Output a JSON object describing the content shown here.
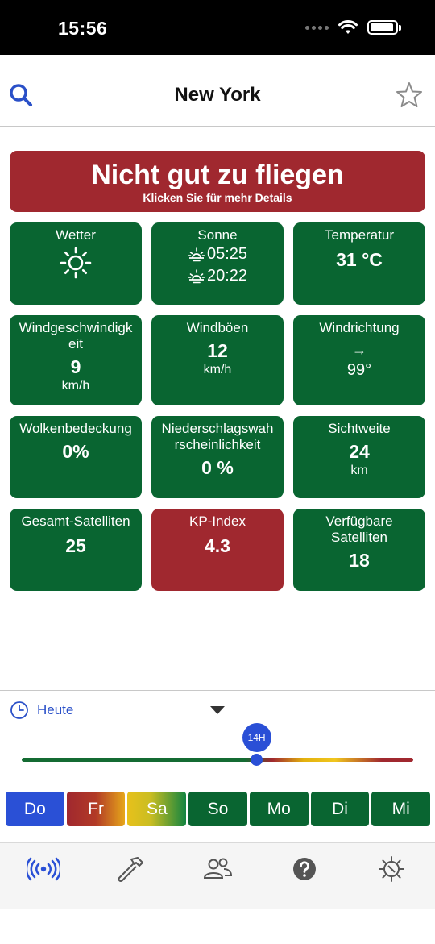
{
  "status_bar": {
    "time": "15:56"
  },
  "header": {
    "title": "New York"
  },
  "banner": {
    "title": "Nicht gut zu fliegen",
    "subtitle": "Klicken Sie für mehr Details"
  },
  "cards": {
    "weather": {
      "label": "Wetter",
      "icon": "sun-icon"
    },
    "sun": {
      "label": "Sonne",
      "sunrise": "05:25",
      "sunset": "20:22"
    },
    "temperature": {
      "label": "Temperatur",
      "value": "31 °C"
    },
    "wind_speed": {
      "label": "Windgeschwindigkeit",
      "value": "9",
      "unit": "km/h"
    },
    "wind_gusts": {
      "label": "Windböen",
      "value": "12",
      "unit": "km/h"
    },
    "wind_direction": {
      "label": "Windrichtung",
      "arrow": "→",
      "value": "99°"
    },
    "cloud_cover": {
      "label": "Wolkenbedeckung",
      "value": "0%"
    },
    "precipitation": {
      "label": "Niederschlagswahrscheinlichkeit",
      "value": "0 %"
    },
    "visibility": {
      "label": "Sichtweite",
      "value": "24",
      "unit": "km"
    },
    "total_satellites": {
      "label": "Gesamt-Satelliten",
      "value": "25"
    },
    "kp_index": {
      "label": "KP-Index",
      "value": "4.3"
    },
    "available_satellites": {
      "label": "Verfügbare Satelliten",
      "value": "18"
    }
  },
  "time_selector": {
    "day_label": "Heute",
    "hour_label": "14H",
    "hour_position": 0.6
  },
  "days": [
    "Do",
    "Fr",
    "Sa",
    "So",
    "Mo",
    "Di",
    "Mi"
  ],
  "colors": {
    "good": "#096531",
    "bad": "#a0282f",
    "accent": "#2a50d6",
    "warning": "#e8c11b"
  },
  "tab_bar": [
    "radio-signal-icon",
    "hammer-icon",
    "people-icon",
    "help-icon",
    "settings-icon"
  ]
}
